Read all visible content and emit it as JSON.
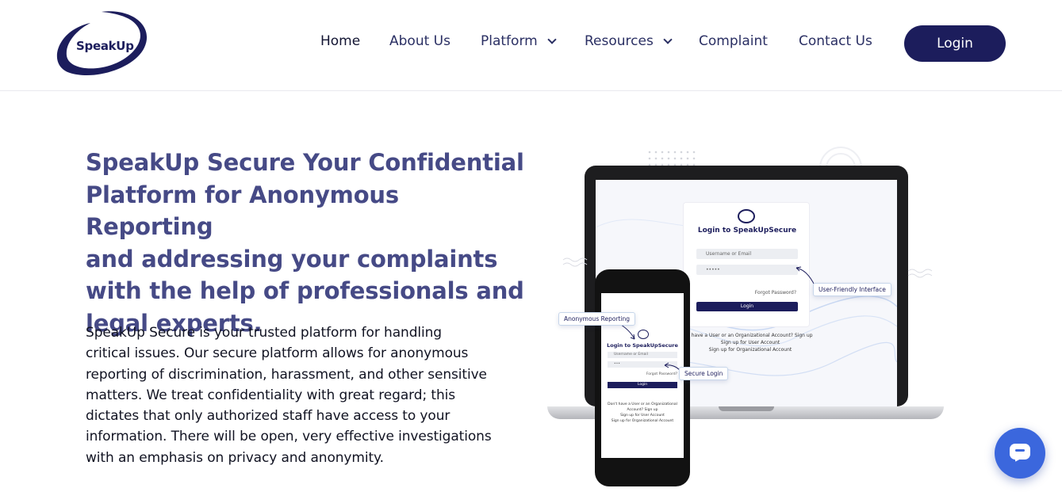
{
  "brand": {
    "name": "SpeakUp",
    "accent": "#1c1d5c",
    "heading_color": "#464a86",
    "chat_color": "#3b67dd"
  },
  "nav": {
    "items": [
      {
        "label": "Home"
      },
      {
        "label": "About Us"
      },
      {
        "label": "Platform",
        "dropdown": true
      },
      {
        "label": "Resources",
        "dropdown": true
      },
      {
        "label": "Complaint"
      },
      {
        "label": "Contact Us"
      }
    ],
    "login_label": "Login"
  },
  "hero": {
    "title_lines": [
      "SpeakUp Secure Your Confidential",
      "Platform for Anonymous Reporting",
      "and addressing your complaints",
      "with the help of professionals and",
      "legal experts."
    ],
    "body_lines": [
      "SpeakUp Secure is your trusted platform for handling",
      "critical issues. Our secure platform allows for anonymous",
      "reporting of discrimination, harassment, and other sensitive",
      "matters. We treat confidentiality with great regard; this",
      "dictates that only authorized staff have access to your",
      "information. There will be open, very effective investigations",
      "with an emphasis on privacy and anonymity."
    ]
  },
  "illustration": {
    "laptop": {
      "card_title": "Login to SpeakUpSecure",
      "username_placeholder": "Username or Email",
      "password_value": "•••••",
      "forgot": "Forgot Password?",
      "button": "Login",
      "below_line1": "t have a User or an Organizational Account? Sign up",
      "below_line2": "Sign up for User Account",
      "below_line3": "Sign up for Organizational Account"
    },
    "phone": {
      "card_title": "Login to SpeakUpSecure",
      "username_placeholder": "Username or Email",
      "password_value": "•••",
      "forgot": "Forgot Password?",
      "button": "Login",
      "below_line1": "Don't have a User or an Organizational",
      "below_line2": "Account? Sign up",
      "below_line3": "Sign up for User Account",
      "below_line4": "Sign up for Organizational Account"
    },
    "callouts": {
      "user_friendly": "User-Friendly Interface",
      "anonymous": "Anonymous Reporting",
      "secure": "Secure Login"
    }
  },
  "chat": {
    "icon": "chat-bubble-icon"
  }
}
